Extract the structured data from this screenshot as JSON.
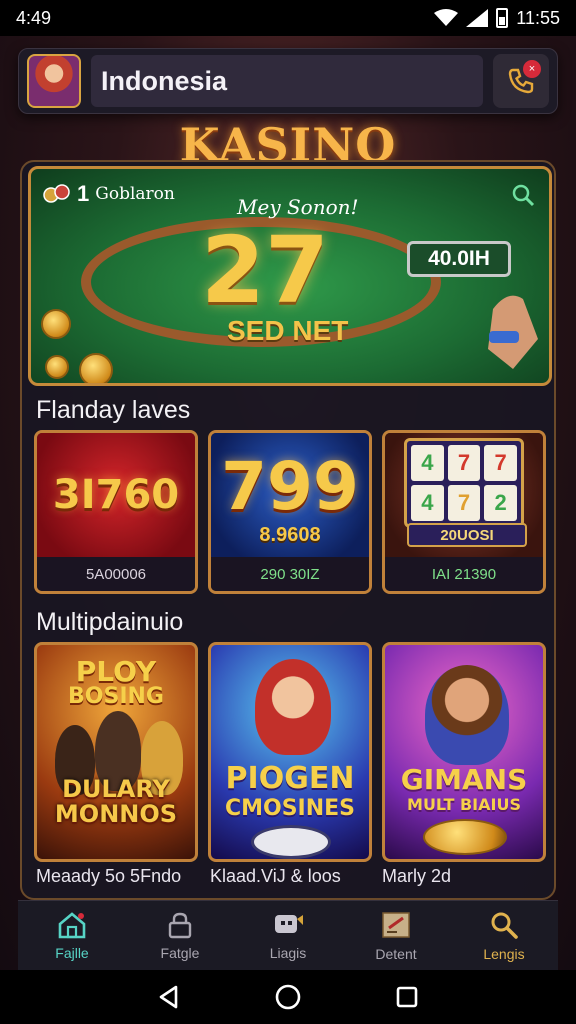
{
  "status_bar": {
    "left_text": "4:49",
    "time": "11:55"
  },
  "header": {
    "region": "Indonesia",
    "notification_badge": "×"
  },
  "title": "KASINO",
  "hero": {
    "count": "1",
    "sub_label": "Goblaron",
    "tagline": "Mey Sonon!",
    "jackpot": "27",
    "tag": "SED NET",
    "amount": "40.0IH"
  },
  "sections": {
    "featured_title": "Flanday laves",
    "multi_title": "Multipdainuio"
  },
  "featured_games": [
    {
      "big": "3I760",
      "caption": "5A00006"
    },
    {
      "big": "799",
      "sub": "8.9608",
      "caption": "290 30IZ"
    },
    {
      "slot_symbols": [
        "4",
        "7",
        "7",
        "4",
        "7",
        "2"
      ],
      "slot_label": "20UOSI",
      "caption": "IAI 21390"
    }
  ],
  "multi_games": [
    {
      "title_top": "PLOY",
      "title_mid": "BOSING",
      "title_bottom": "DULARY MONNOS",
      "caption": "Meaady 5o 5Fndo"
    },
    {
      "title_top": "PIOGEN",
      "title_bottom": "CMOSINES",
      "caption": "Klaad.ViJ & loos"
    },
    {
      "title_top": "GIMANS",
      "title_bottom": "MULT BIAIUS",
      "caption": "Marly 2d"
    }
  ],
  "bottom_nav": [
    {
      "label": "Fajlle",
      "icon": "home-icon"
    },
    {
      "label": "Fatgle",
      "icon": "lock-icon"
    },
    {
      "label": "Liagis",
      "icon": "chat-icon"
    },
    {
      "label": "Detent",
      "icon": "document-icon"
    },
    {
      "label": "Lengis",
      "icon": "search-icon"
    }
  ],
  "colors": {
    "accent": "#57d4c6",
    "gold": "#f6c94a",
    "panel": "#191622",
    "felt": "#1c6b33"
  }
}
